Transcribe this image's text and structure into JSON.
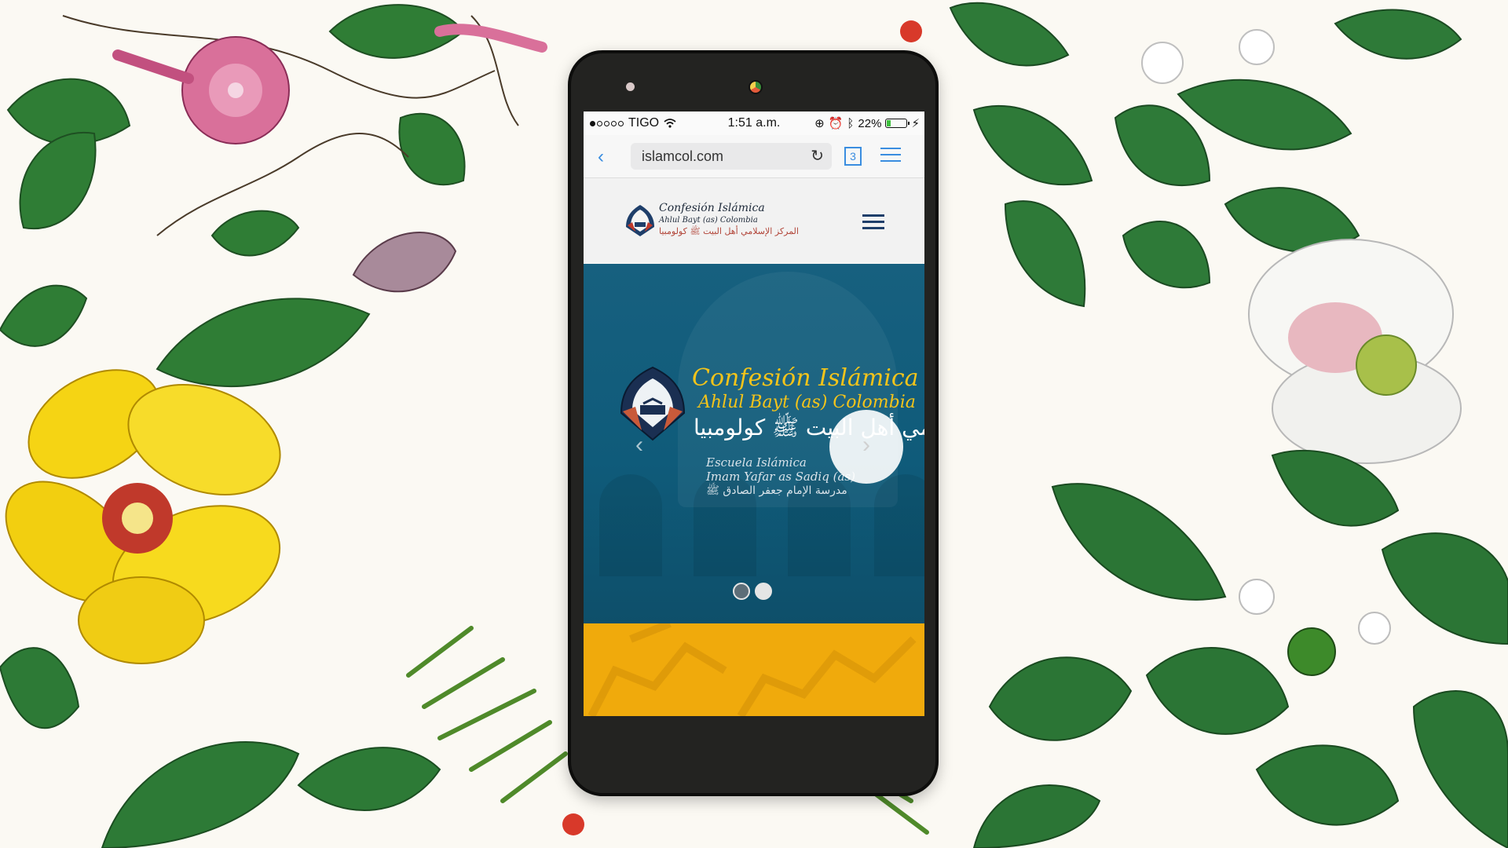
{
  "status_bar": {
    "carrier": "TIGO",
    "time": "1:51 a.m.",
    "battery": "22%",
    "battery_level": 0.22
  },
  "browser": {
    "url": "islamcol.com",
    "tab_count": "3"
  },
  "site": {
    "logo": {
      "line1": "Confesión Islámica",
      "line2": "Ahlul Bayt (as) Colombia",
      "line3": "المركز الإسلامي أهل البيت ﷺ كولومبيا"
    }
  },
  "hero": {
    "title": "Confesión Islámica",
    "subtitle": "Ahlul Bayt (as) Colombia",
    "arabic": "الإسلامي أهل البيت ﷺ كولومبيا",
    "school_line1": "Escuela Islámica",
    "school_line2": "Imam Yafar as Sadiq (as)",
    "school_line3": "مدرسة الإمام جعفر الصادق ﷺ",
    "slides_total": 2,
    "active_slide": 1
  },
  "icons": {
    "wifi": "wifi-icon",
    "reload": "reload-icon",
    "back": "chevron-left-icon",
    "menu": "hamburger-icon",
    "next": "chevron-right-icon"
  },
  "colors": {
    "hero_bg": "#0f5b7a",
    "title_yellow": "#f4c41a",
    "band_orange": "#f0aa0c",
    "ios_blue": "#3a8de0"
  }
}
